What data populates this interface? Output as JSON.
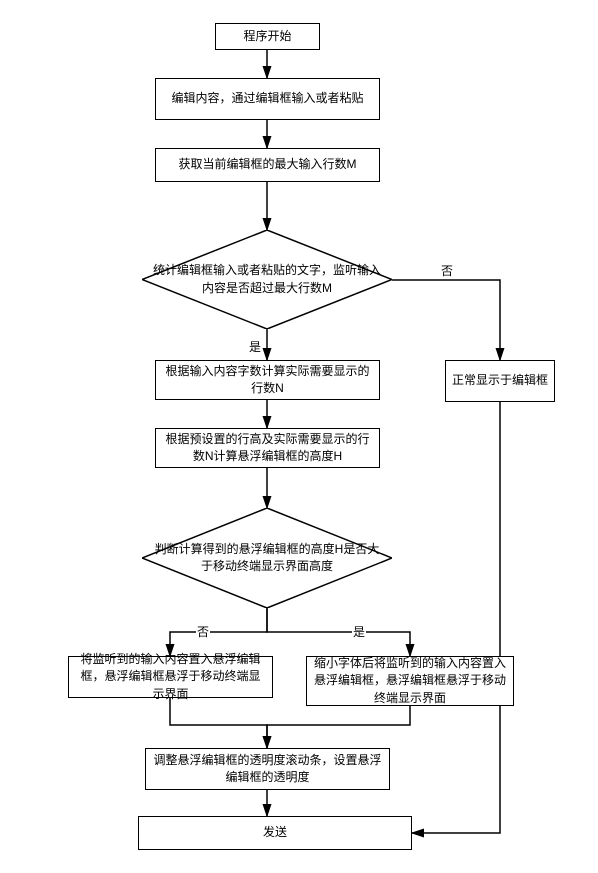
{
  "chart_data": {
    "type": "flowchart",
    "title": "",
    "nodes": [
      {
        "id": "n1",
        "type": "process",
        "text": "程序开始"
      },
      {
        "id": "n2",
        "type": "process",
        "text": "编辑内容，通过编辑框输入或者粘贴"
      },
      {
        "id": "n3",
        "type": "process",
        "text": "获取当前编辑框的最大输入行数M"
      },
      {
        "id": "d1",
        "type": "decision",
        "text": "统计编辑框输入或者粘贴的文字，监听输入内容是否超过最大行数M"
      },
      {
        "id": "n4",
        "type": "process",
        "text": "根据输入内容字数计算实际需要显示的行数N"
      },
      {
        "id": "n5",
        "type": "process",
        "text": "正常显示于编辑框"
      },
      {
        "id": "n6",
        "type": "process",
        "text": "根据预设置的行高及实际需要显示的行数N计算悬浮编辑框的高度H"
      },
      {
        "id": "d2",
        "type": "decision",
        "text": "判断计算得到的悬浮编辑框的高度H是否大于移动终端显示界面高度"
      },
      {
        "id": "n7",
        "type": "process",
        "text": "将监听到的输入内容置入悬浮编辑框，悬浮编辑框悬浮于移动终端显示界面"
      },
      {
        "id": "n8",
        "type": "process",
        "text": "缩小字体后将监听到的输入内容置入悬浮编辑框，悬浮编辑框悬浮于移动终端显示界面"
      },
      {
        "id": "n9",
        "type": "process",
        "text": "调整悬浮编辑框的透明度滚动条，设置悬浮编辑框的透明度"
      },
      {
        "id": "n10",
        "type": "process",
        "text": "发送"
      }
    ],
    "edges": [
      {
        "from": "n1",
        "to": "n2"
      },
      {
        "from": "n2",
        "to": "n3"
      },
      {
        "from": "n3",
        "to": "d1"
      },
      {
        "from": "d1",
        "to": "n4",
        "label": "是"
      },
      {
        "from": "d1",
        "to": "n5",
        "label": "否"
      },
      {
        "from": "n4",
        "to": "n6"
      },
      {
        "from": "n6",
        "to": "d2"
      },
      {
        "from": "d2",
        "to": "n7",
        "label": "否"
      },
      {
        "from": "d2",
        "to": "n8",
        "label": "是"
      },
      {
        "from": "n7",
        "to": "n9"
      },
      {
        "from": "n8",
        "to": "n9"
      },
      {
        "from": "n9",
        "to": "n10"
      },
      {
        "from": "n5",
        "to": "n10"
      }
    ],
    "labels": {
      "yes": "是",
      "no": "否"
    }
  }
}
